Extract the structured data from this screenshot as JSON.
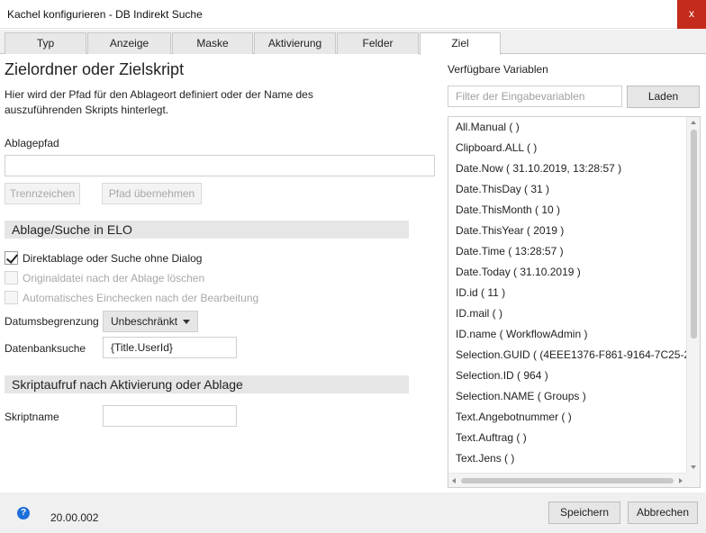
{
  "window": {
    "title": "Kachel konfigurieren - DB Indirekt Suche",
    "close_label": "x"
  },
  "tabs": [
    {
      "label": "Typ"
    },
    {
      "label": "Anzeige"
    },
    {
      "label": "Maske"
    },
    {
      "label": "Aktivierung"
    },
    {
      "label": "Felder"
    },
    {
      "label": "Ziel",
      "active": true
    }
  ],
  "main": {
    "heading": "Zielordner oder Zielskript",
    "description": "Hier wird der Pfad für den Ablageort definiert oder der Name des auszuführenden Skripts hinterlegt.",
    "ablagepfad_label": "Ablagepfad",
    "ablagepfad_value": "",
    "trennzeichen_label": "Trennzeichen",
    "pfad_uebernehmen_label": "Pfad übernehmen",
    "section_ablage": "Ablage/Suche in ELO",
    "check_direktablage": {
      "label": "Direktablage oder Suche ohne Dialog",
      "checked": true
    },
    "check_originaldatei": {
      "label": "Originaldatei nach der Ablage löschen",
      "checked": false,
      "disabled": true
    },
    "check_einchecken": {
      "label": "Automatisches Einchecken nach der Bearbeitung",
      "checked": false,
      "disabled": true
    },
    "datumsbegrenzung_label": "Datumsbegrenzung",
    "datumsbegrenzung_value": "Unbeschränkt",
    "datenbanksuche_label": "Datenbanksuche",
    "datenbanksuche_value": "{Title.UserId}",
    "section_skript": "Skriptaufruf nach Aktivierung oder Ablage",
    "skriptname_label": "Skriptname",
    "skriptname_value": ""
  },
  "variables": {
    "title": "Verfügbare Variablen",
    "filter_placeholder": "Filter der Eingabevariablen",
    "laden_label": "Laden",
    "items": [
      "All.Manual ( )",
      "Clipboard.ALL ( )",
      "Date.Now ( 31.10.2019, 13:28:57 )",
      "Date.ThisDay ( 31 )",
      "Date.ThisMonth ( 10 )",
      "Date.ThisYear ( 2019 )",
      "Date.Time ( 13:28:57 )",
      "Date.Today ( 31.10.2019 )",
      "ID.id ( 11 )",
      "ID.mail ( )",
      "ID.name ( WorkflowAdmin )",
      "Selection.GUID ( (4EEE1376-F861-9164-7C25-2D...",
      "Selection.ID ( 964 )",
      "Selection.NAME ( Groups )",
      "Text.Angebotnummer ( )",
      "Text.Auftrag ( )",
      "Text.Jens ( )"
    ]
  },
  "footer": {
    "version": "20.00.002",
    "save_label": "Speichern",
    "cancel_label": "Abbrechen"
  }
}
